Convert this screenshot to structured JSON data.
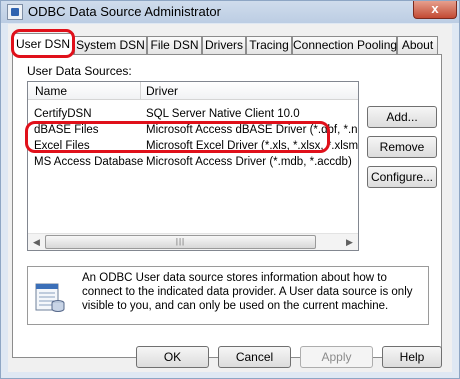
{
  "window": {
    "title": "ODBC Data Source Administrator",
    "close_glyph": "x"
  },
  "tabs": [
    {
      "label": "User DSN",
      "active": true
    },
    {
      "label": "System DSN"
    },
    {
      "label": "File DSN"
    },
    {
      "label": "Drivers"
    },
    {
      "label": "Tracing"
    },
    {
      "label": "Connection Pooling"
    },
    {
      "label": "About"
    }
  ],
  "user_dsn": {
    "group_label": "User Data Sources:",
    "columns": [
      "Name",
      "Driver"
    ],
    "rows": [
      {
        "name": "CertifyDSN",
        "driver": "SQL Server Native Client 10.0"
      },
      {
        "name": "dBASE Files",
        "driver": "Microsoft Access dBASE Driver (*.dbf, *.ndx"
      },
      {
        "name": "Excel Files",
        "driver": "Microsoft Excel Driver (*.xls, *.xlsx, *.xlsm, *.x"
      },
      {
        "name": "MS Access Database",
        "driver": "Microsoft Access Driver (*.mdb, *.accdb)"
      }
    ],
    "scroll_left": "◀",
    "scroll_right": "▶",
    "scroll_grip": "|||",
    "buttons": {
      "add": "Add...",
      "remove": "Remove",
      "configure": "Configure..."
    },
    "info_text": "An ODBC User data source stores information about how to connect to the indicated data provider.   A User data source is only visible to you, and can only be used on the current machine.",
    "info_icon": "data-source-icon"
  },
  "footer": {
    "ok": "OK",
    "cancel": "Cancel",
    "apply": "Apply",
    "help": "Help"
  },
  "annotation_color": "#e0101a"
}
